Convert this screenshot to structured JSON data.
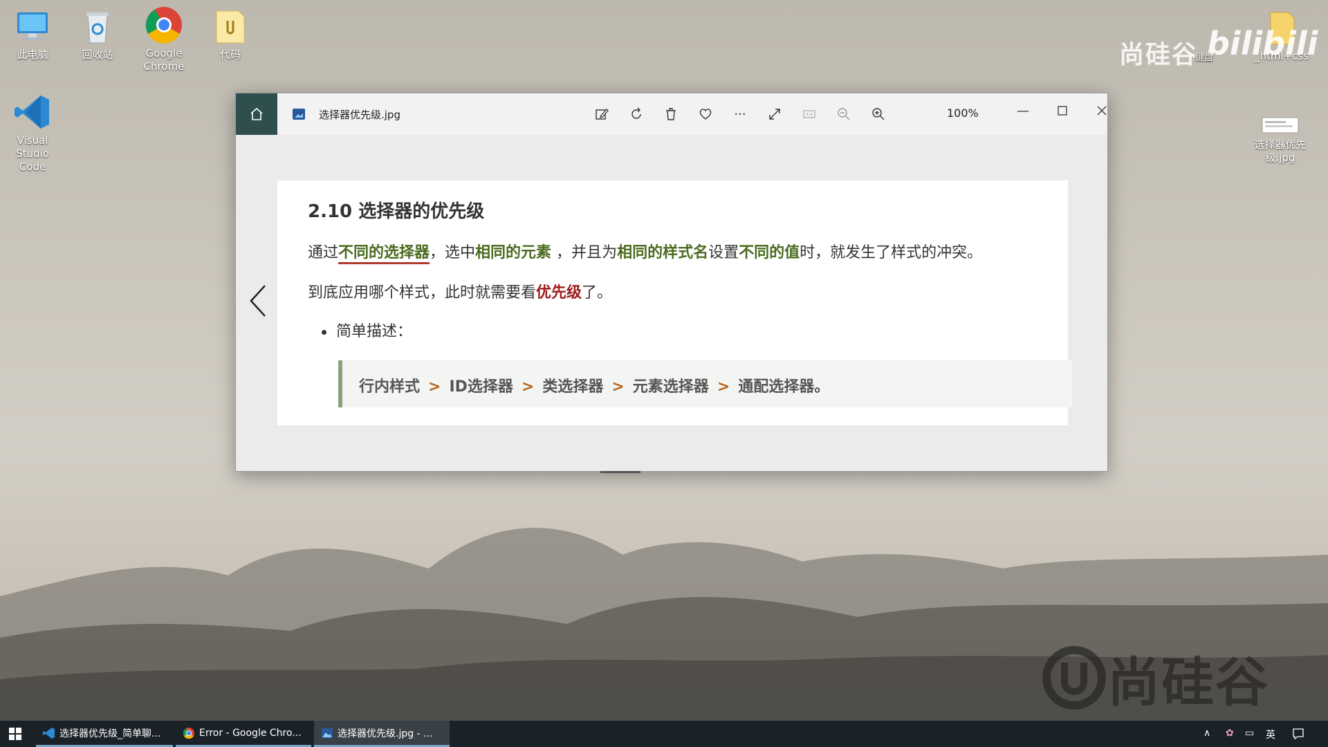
{
  "desktop": {
    "icons": [
      {
        "label": "此电脑",
        "icon": "computer-icon"
      },
      {
        "label": "回收站",
        "icon": "recycle-bin-icon"
      },
      {
        "label_line1": "Google",
        "label_line2": "Chrome",
        "icon": "chrome-icon"
      },
      {
        "label": "代码",
        "icon": "folder-icon"
      },
      {
        "label_line1": "Visual",
        "label_line2": "Studio Code",
        "icon": "vscode-icon"
      }
    ],
    "right_icons": [
      {
        "label": "_html+css",
        "icon": "folder-icon"
      },
      {
        "label_line1": "选择器优先",
        "label_line2": "级.jpg",
        "icon": "image-file-icon"
      }
    ],
    "watermark_top": "尚硅谷",
    "watermark_bili": "bilibili",
    "watermark_small": "键盘",
    "watermark_bottom": "尚硅谷"
  },
  "viewer": {
    "filename": "选择器优先级.jpg",
    "zoom": "100%",
    "toolbar": [
      "edit-icon",
      "rotate-icon",
      "delete-icon",
      "favorite-icon",
      "more-icon",
      "fullscreen-icon",
      "actual-size-icon",
      "zoom-out-icon",
      "zoom-in-icon"
    ]
  },
  "image_content": {
    "title": "2.10 选择器的优先级",
    "p1": {
      "t1": "通过",
      "h1": "不同的选择器",
      "t2": "，选中",
      "h2": "相同的元素",
      "t3": " ，并且为",
      "h3": "相同的样式名",
      "t4": "设置",
      "h4": "不同的值",
      "t5": "时，就发生了样式的冲突。"
    },
    "p2": {
      "t1": "到底应用哪个样式，此时就需要看",
      "h1": "优先级",
      "t2": "了。"
    },
    "bullet": "简单描述：",
    "quote": {
      "items": [
        "行内样式",
        "ID选择器",
        "类选择器",
        "元素选择器",
        "通配选择器。"
      ],
      "separator": ">"
    }
  },
  "taskbar": {
    "items": [
      {
        "label": "选择器优先级_简单聊...",
        "icon": "vscode-icon"
      },
      {
        "label": "Error - Google Chro...",
        "icon": "chrome-icon"
      },
      {
        "label": "选择器优先级.jpg - ...",
        "icon": "photos-icon"
      }
    ],
    "ime": "英"
  }
}
